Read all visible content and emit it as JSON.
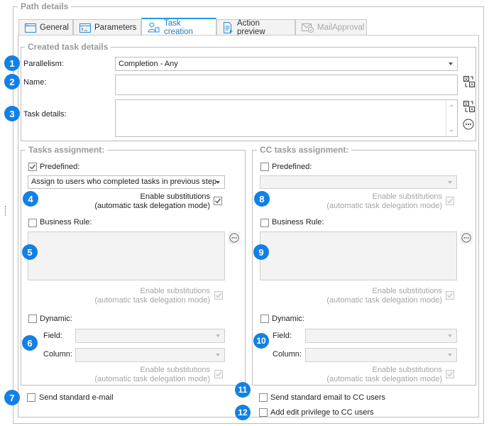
{
  "group_title": "Path details",
  "tabs": [
    {
      "label": "General",
      "icon": "window-icon",
      "state": "normal"
    },
    {
      "label": "Parameters",
      "icon": "console-icon",
      "state": "normal"
    },
    {
      "label": "Task creation",
      "icon": "users-task-icon",
      "state": "active"
    },
    {
      "label": "Action preview",
      "icon": "document-preview-icon",
      "state": "normal"
    },
    {
      "label": "MailApproval",
      "icon": "mail-approval-icon",
      "state": "disabled"
    }
  ],
  "created_task": {
    "title": "Created task details",
    "parallelism_label": "Parallelism:",
    "parallelism_value": "Completion - Any",
    "name_label": "Name:",
    "name_value": "",
    "details_label": "Task details:",
    "details_value": ""
  },
  "tasks_assignment": {
    "title": "Tasks assignment:",
    "predefined_label": "Predefined:",
    "predefined_checked": true,
    "predefined_value": "Assign to users who completed tasks in previous step",
    "substitution_line1": "Enable substitutions",
    "substitution_line2": "(automatic task delegation mode)",
    "business_rule_label": "Business Rule:",
    "business_rule_checked": false,
    "dynamic_label": "Dynamic:",
    "dynamic_checked": false,
    "field_label": "Field:",
    "column_label": "Column:"
  },
  "cc_assignment": {
    "title": "CC tasks assignment:",
    "predefined_label": "Predefined:",
    "predefined_checked": false,
    "predefined_value": "",
    "substitution_line1": "Enable substitutions",
    "substitution_line2": "(automatic task delegation mode)",
    "business_rule_label": "Business Rule:",
    "business_rule_checked": false,
    "dynamic_label": "Dynamic:",
    "dynamic_checked": false,
    "field_label": "Field:",
    "column_label": "Column:"
  },
  "bottom": {
    "send_email_label": "Send standard e-mail",
    "send_cc_email_label": "Send standard email to CC users",
    "add_edit_privilege_label": "Add edit privilege to CC users"
  },
  "badges": [
    "1",
    "2",
    "3",
    "4",
    "5",
    "6",
    "7",
    "8",
    "9",
    "10",
    "11",
    "12"
  ],
  "colors": {
    "accent": "#1e9be6",
    "badge": "#1380e6",
    "border": "#bdbdbd",
    "legend": "#9a9a9a"
  }
}
